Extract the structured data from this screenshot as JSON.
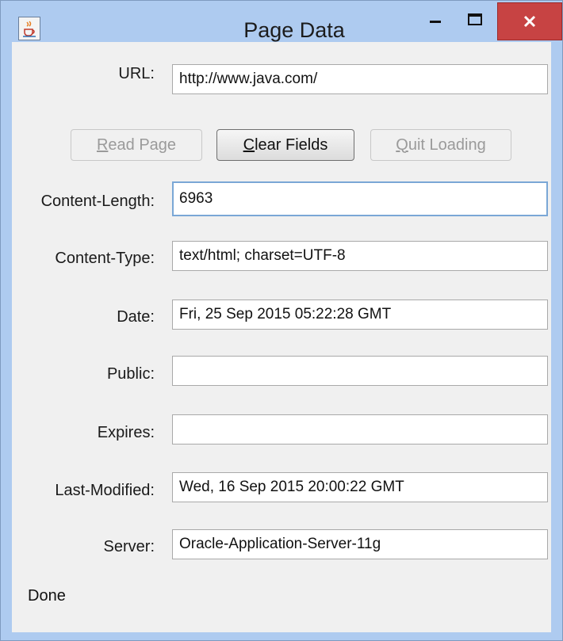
{
  "window": {
    "title": "Page Data",
    "icon": "java-cup-icon",
    "controls": {
      "minimize": "minimize-icon",
      "maximize": "maximize-icon",
      "close": "close-icon"
    },
    "close_color": "#c74343"
  },
  "url": {
    "label": "URL:",
    "value": "http://www.java.com/"
  },
  "buttons": {
    "read_page": {
      "prefix": "",
      "mnemonic": "R",
      "rest": "ead Page",
      "enabled": false
    },
    "clear_fields": {
      "prefix": "",
      "mnemonic": "C",
      "rest": "lear Fields",
      "enabled": true
    },
    "quit_loading": {
      "prefix": "",
      "mnemonic": "Q",
      "rest": "uit Loading",
      "enabled": false
    }
  },
  "fields": [
    {
      "label": "Content-Length:",
      "value": "6963",
      "focused": true
    },
    {
      "label": "Content-Type:",
      "value": "text/html; charset=UTF-8"
    },
    {
      "label": "Date:",
      "value": "Fri, 25 Sep 2015 05:22:28 GMT"
    },
    {
      "label": "Public:",
      "value": ""
    },
    {
      "label": "Expires:",
      "value": ""
    },
    {
      "label": "Last-Modified:",
      "value": "Wed, 16 Sep 2015 20:00:22 GMT"
    },
    {
      "label": "Server:",
      "value": "Oracle-Application-Server-11g"
    }
  ],
  "status": "Done"
}
